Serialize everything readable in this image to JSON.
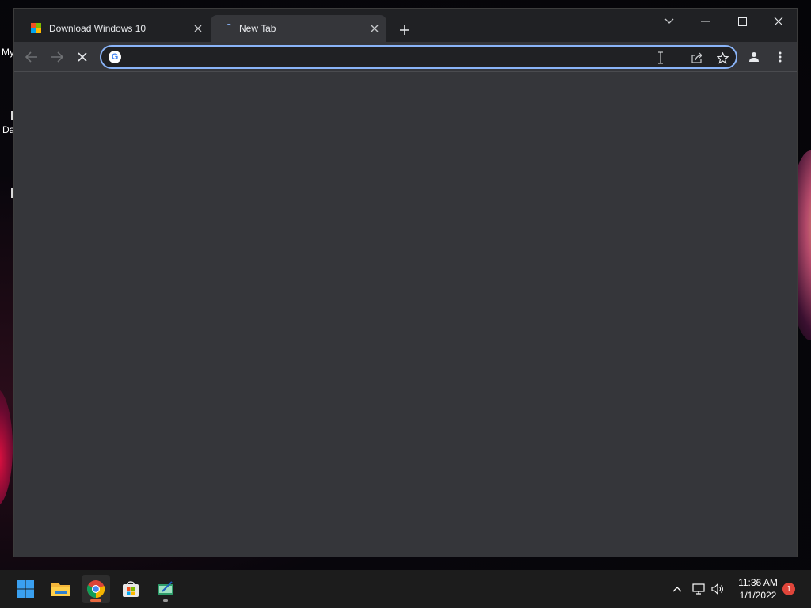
{
  "desktop": {
    "labels": [
      "My",
      "Da"
    ]
  },
  "browser": {
    "tabs": [
      {
        "title": "Download Windows 10",
        "icon": "microsoft-logo-icon",
        "active": false
      },
      {
        "title": "New Tab",
        "icon": "loading-spinner-icon",
        "active": true
      }
    ],
    "new_tab_icon": "plus-icon",
    "window_controls": [
      "tab-search-icon",
      "minimize-icon",
      "maximize-icon",
      "close-icon"
    ],
    "toolbar": {
      "back_icon": "back-arrow-icon",
      "forward_icon": "forward-arrow-icon",
      "stop_icon": "stop-loading-icon"
    },
    "omnibox": {
      "icon": "google-icon",
      "google_letter": "G",
      "value": "",
      "placeholder": ""
    },
    "omnibox_icons": [
      "share-icon",
      "bookmark-star-icon"
    ],
    "profile_icon": "profile-icon",
    "menu_icon": "kebab-menu-icon",
    "accent": "#8ab4f8",
    "content_bg": "#35363a"
  },
  "taskbar": {
    "apps": [
      {
        "name": "start",
        "icon": "windows-start-icon"
      },
      {
        "name": "file-explorer",
        "icon": "folder-icon"
      },
      {
        "name": "chrome",
        "icon": "chrome-icon",
        "active": true
      },
      {
        "name": "microsoft-store",
        "icon": "store-bag-icon"
      },
      {
        "name": "app",
        "icon": "green-app-icon",
        "running": true
      }
    ],
    "tray": [
      "chevron-up-icon",
      "network-icon",
      "volume-icon"
    ],
    "time": "11:36 AM",
    "date": "1/1/2022",
    "notification_count": "1"
  }
}
